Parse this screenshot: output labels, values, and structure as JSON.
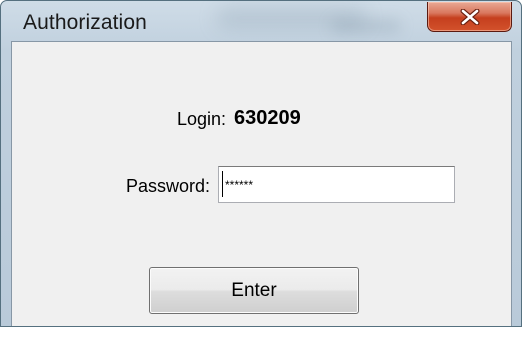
{
  "window": {
    "title": "Authorization",
    "close_icon": "close-x-icon"
  },
  "form": {
    "login_label": "Login:",
    "login_value": "630209",
    "password_label": "Password:",
    "password_value": "******",
    "enter_label": "Enter"
  },
  "colors": {
    "close_button": "#c53f1e",
    "client_area": "#f0f0f0",
    "frame": "#c0d0de"
  }
}
